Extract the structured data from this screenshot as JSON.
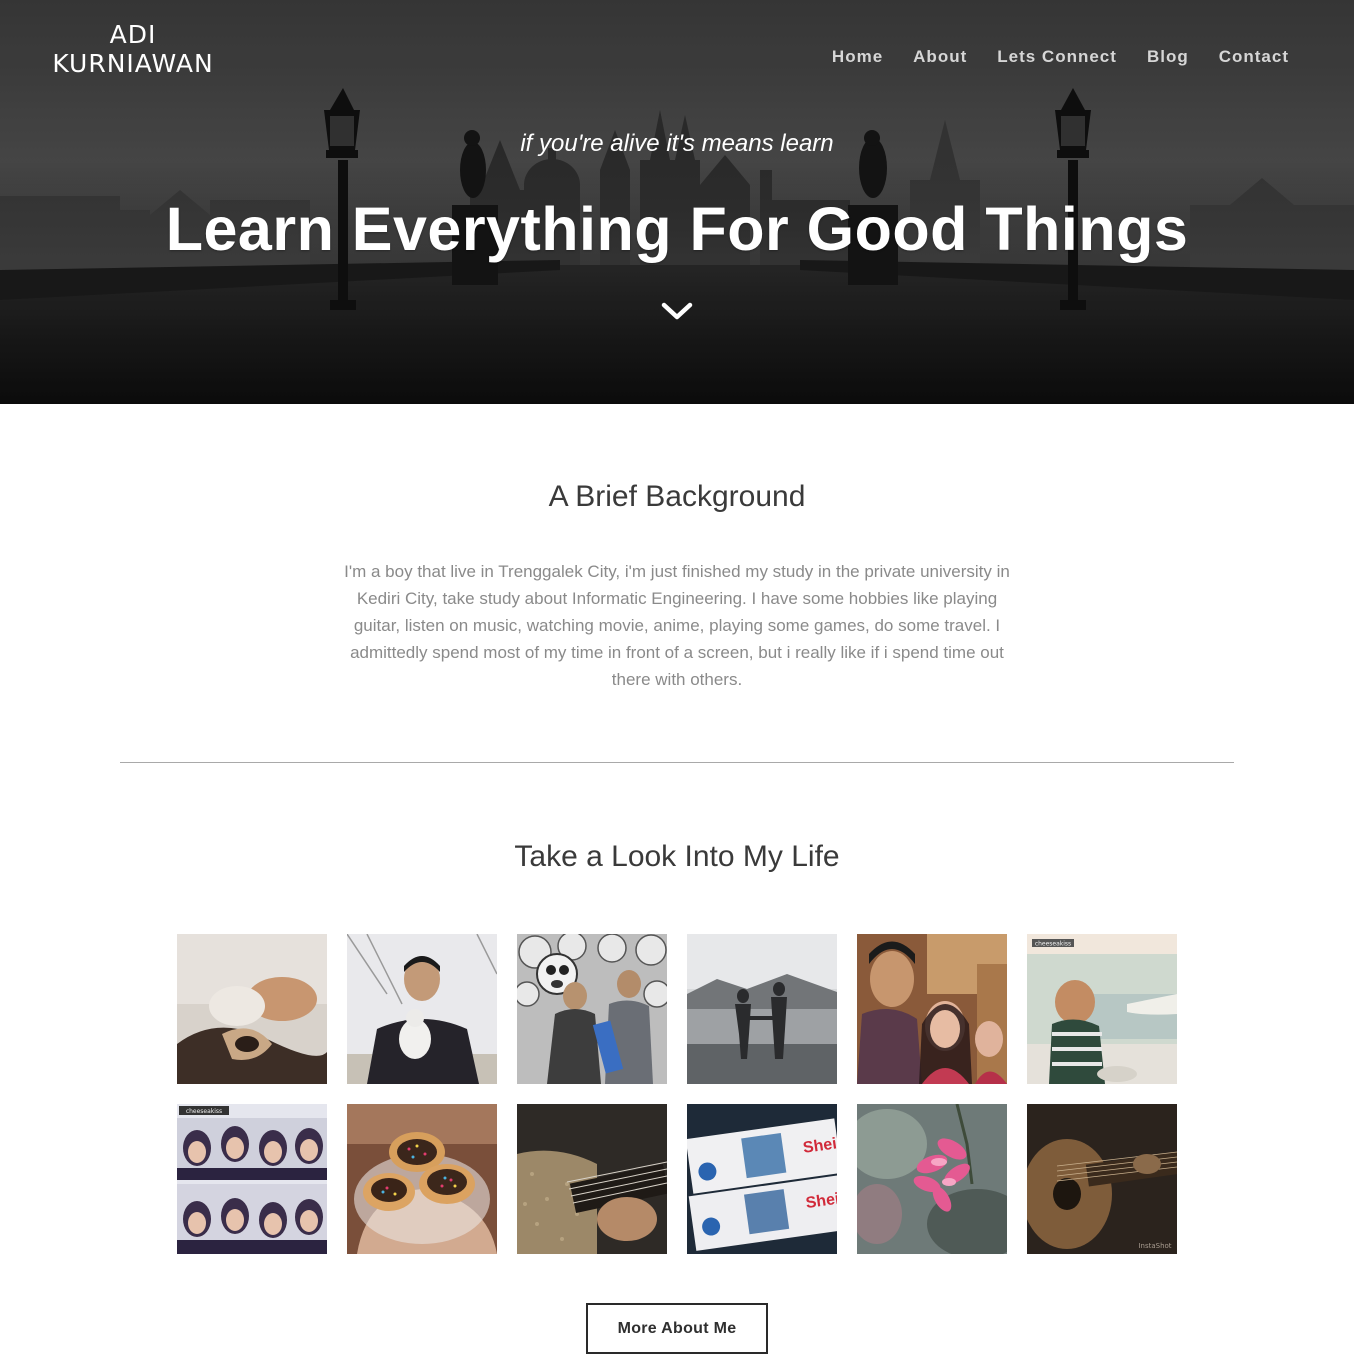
{
  "header": {
    "brand_line1": "ADI",
    "brand_line2": "KURNIAWAN",
    "nav": [
      {
        "label": "Home"
      },
      {
        "label": "About"
      },
      {
        "label": "Lets Connect"
      },
      {
        "label": "Blog"
      },
      {
        "label": "Contact"
      }
    ]
  },
  "hero": {
    "tagline": "if you're alive it's means learn",
    "headline": "Learn Everything For Good Things",
    "scroll_icon": "chevron-down-icon"
  },
  "about": {
    "title": "A Brief Background",
    "text": "I'm a boy that live in Trenggalek City, i'm just finished my study in the private university in Kediri City, take study about Informatic Engineering. I have some hobbies like playing guitar, listen on music, watching movie, anime, playing some games, do some travel. I admittedly spend most of my time in front of a screen, but i really like if i spend time out there with others."
  },
  "gallery": {
    "title": "Take a Look Into My Life",
    "photos": [
      {
        "subject": "kittens-on-blanket"
      },
      {
        "subject": "man-holding-white-cat"
      },
      {
        "subject": "two-friends-with-emoji-wall"
      },
      {
        "subject": "couple-holding-hands-at-beach"
      },
      {
        "subject": "selfie-with-two-girls"
      },
      {
        "subject": "baby-laughing"
      },
      {
        "subject": "photobooth-collage"
      },
      {
        "subject": "donuts-with-sprinkles"
      },
      {
        "subject": "playing-ukulele"
      },
      {
        "subject": "concert-tickets"
      },
      {
        "subject": "pink-flowers"
      },
      {
        "subject": "playing-acoustic-guitar"
      }
    ],
    "watermark_small": "cheeseakiss",
    "watermark_instashot": "InstaShot",
    "button_label": "More About Me"
  },
  "colors": {
    "hero_overlay": "#3d3d3d",
    "text_primary": "#3a3a3a",
    "text_muted": "#8a8a8a",
    "divider": "#a9a9a9"
  }
}
